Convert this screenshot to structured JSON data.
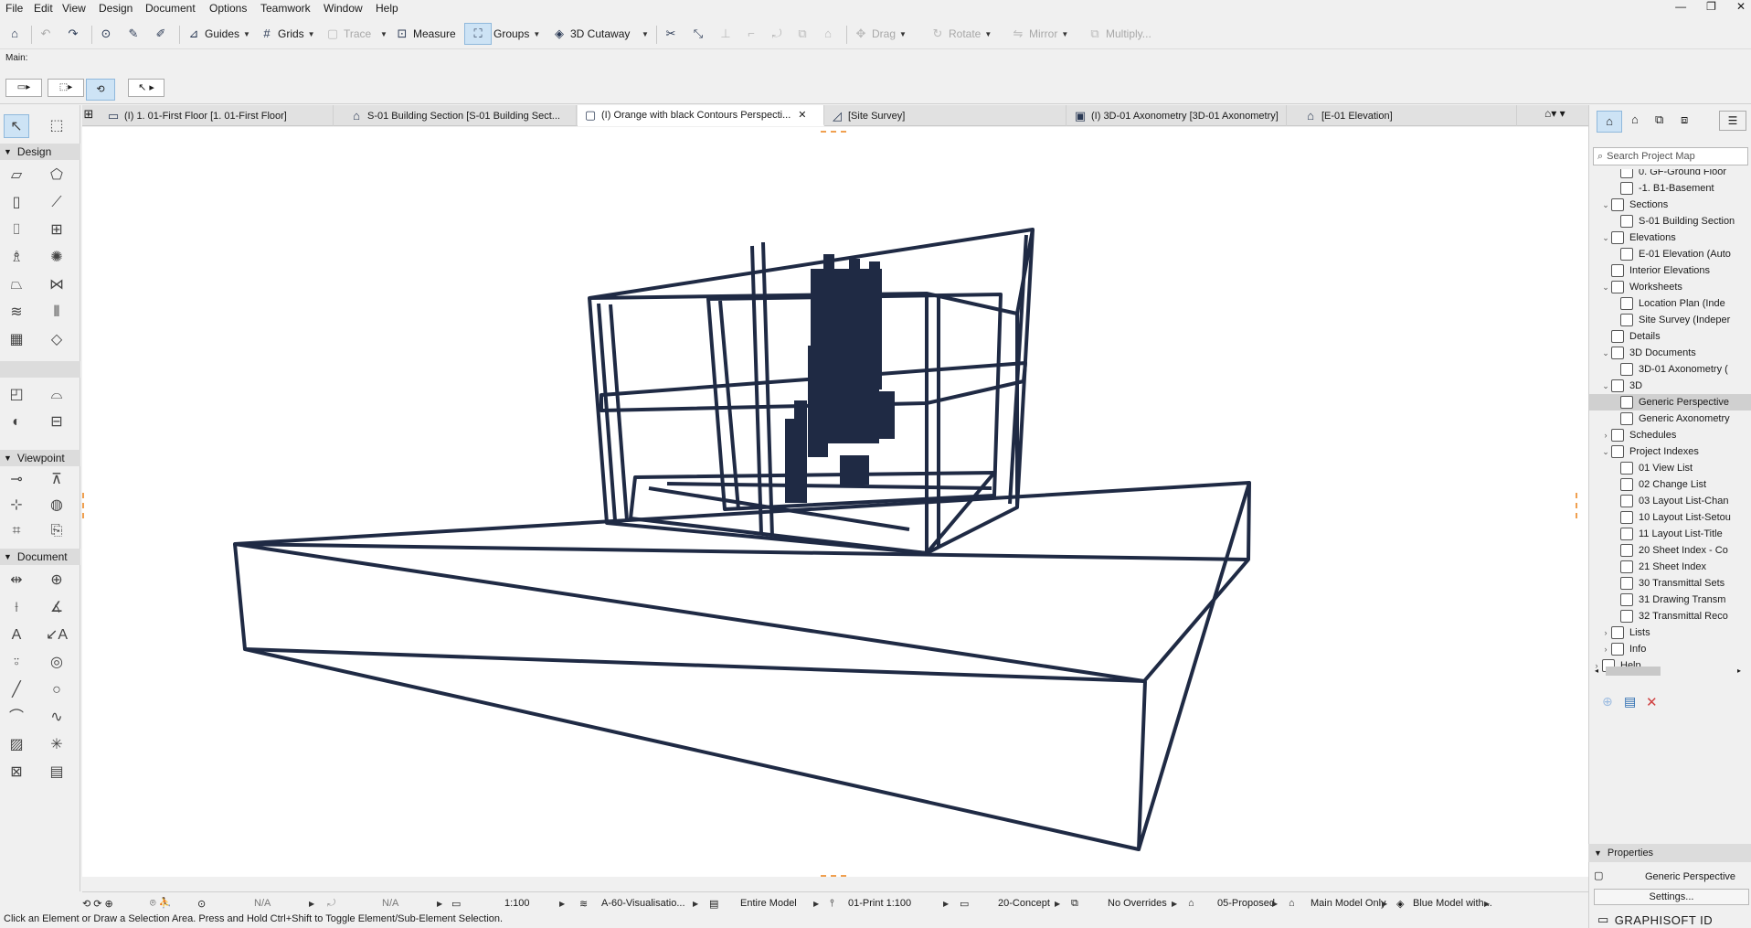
{
  "menubar": {
    "items": [
      "File",
      "Edit",
      "View",
      "Design",
      "Document",
      "Options",
      "Teamwork",
      "Window",
      "Help"
    ],
    "window_controls": [
      "—",
      "❐",
      "✕"
    ]
  },
  "toolbar": {
    "guides": "Guides",
    "grids": "Grids",
    "trace": "Trace",
    "measure": "Measure",
    "groups": "Groups",
    "cutaway": "3D Cutaway",
    "drag": "Drag",
    "rotate": "Rotate",
    "mirror": "Mirror",
    "multiply": "Multiply..."
  },
  "infobox": {
    "label": "Main:"
  },
  "tabs": [
    {
      "label": "(I) 1. 01-First Floor [1. 01-First Floor]"
    },
    {
      "label": "S-01 Building Section [S-01 Building Sect..."
    },
    {
      "label": "(I) Orange with black Contours Perspecti...",
      "active": true
    },
    {
      "label": "[Site Survey]"
    },
    {
      "label": "(I) 3D-01 Axonometry [3D-01 Axonometry]"
    },
    {
      "label": "[E-01 Elevation]"
    }
  ],
  "toolbox": {
    "design": "Design",
    "viewpoint": "Viewpoint",
    "document": "Document"
  },
  "navigator": {
    "search_placeholder": "Search Project Map",
    "items": [
      {
        "label": "0. GF-Ground Floor",
        "indent": 3
      },
      {
        "label": "-1. B1-Basement",
        "indent": 3
      },
      {
        "label": "Sections",
        "indent": 2,
        "twisty": "v"
      },
      {
        "label": "S-01 Building Section",
        "indent": 3
      },
      {
        "label": "Elevations",
        "indent": 2,
        "twisty": "v"
      },
      {
        "label": "E-01 Elevation (Auto",
        "indent": 3
      },
      {
        "label": "Interior Elevations",
        "indent": 2
      },
      {
        "label": "Worksheets",
        "indent": 2,
        "twisty": "v"
      },
      {
        "label": "Location Plan (Inde",
        "indent": 3
      },
      {
        "label": "Site Survey (Indeper",
        "indent": 3
      },
      {
        "label": "Details",
        "indent": 2
      },
      {
        "label": "3D Documents",
        "indent": 2,
        "twisty": "v"
      },
      {
        "label": "3D-01 Axonometry (",
        "indent": 3
      },
      {
        "label": "3D",
        "indent": 2,
        "twisty": "v"
      },
      {
        "label": "Generic Perspective",
        "indent": 3,
        "selected": true
      },
      {
        "label": "Generic Axonometry",
        "indent": 3
      },
      {
        "label": "Schedules",
        "indent": 2,
        "twisty": ">"
      },
      {
        "label": "Project Indexes",
        "indent": 2,
        "twisty": "v"
      },
      {
        "label": "01 View List",
        "indent": 3
      },
      {
        "label": "02 Change List",
        "indent": 3
      },
      {
        "label": "03 Layout List-Chan",
        "indent": 3
      },
      {
        "label": "10 Layout List-Setou",
        "indent": 3
      },
      {
        "label": "11 Layout List-Title",
        "indent": 3
      },
      {
        "label": "20 Sheet Index - Co",
        "indent": 3
      },
      {
        "label": "21 Sheet Index",
        "indent": 3
      },
      {
        "label": "30 Transmittal Sets",
        "indent": 3
      },
      {
        "label": "31 Drawing Transm",
        "indent": 3
      },
      {
        "label": "32 Transmittal Reco",
        "indent": 3
      },
      {
        "label": "Lists",
        "indent": 2,
        "twisty": ">"
      },
      {
        "label": "Info",
        "indent": 2,
        "twisty": ">"
      },
      {
        "label": "Help",
        "indent": 1,
        "twisty": ">"
      }
    ]
  },
  "properties": {
    "header": "Properties",
    "name": "Generic Perspective",
    "settings_label": "Settings..."
  },
  "statusbar": {
    "na1": "N/A",
    "na2": "N/A",
    "scale": "1:100",
    "layer": "A-60-Visualisatio...",
    "model": "Entire Model",
    "pen": "01-Print 1:100",
    "mvo": "20-Concept",
    "overrides": "No Overrides",
    "renovation": "05-Proposed",
    "structure": "Main Model Only",
    "style": "Blue Model with..."
  },
  "hint": "Click an Element or Draw a Selection Area. Press and Hold Ctrl+Shift to Toggle Element/Sub-Element Selection.",
  "brand": "GRAPHISOFT ID",
  "colors": {
    "model_lines": "#1f2a44",
    "canvas": "#ffffff",
    "accent": "#2b6cb0"
  }
}
